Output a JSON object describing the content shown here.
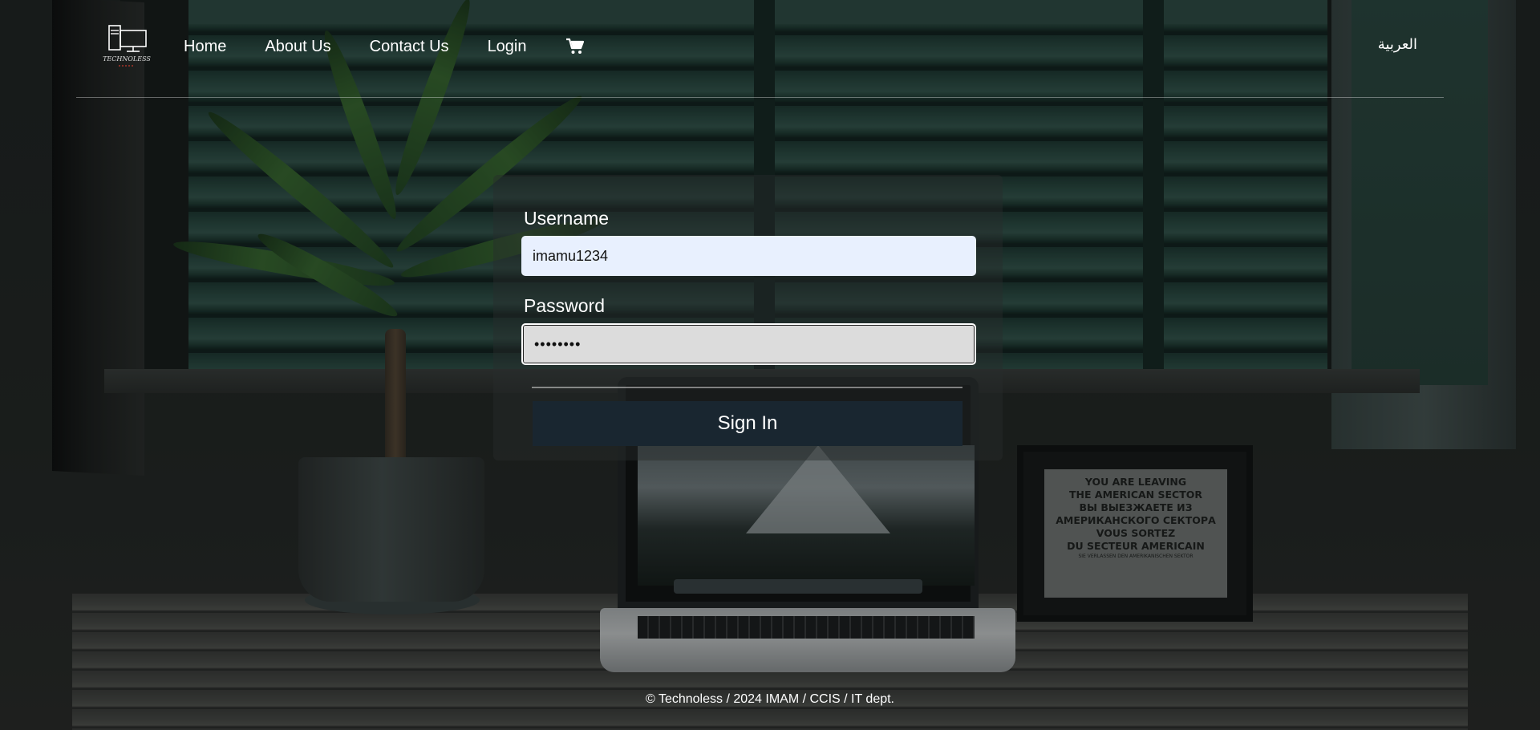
{
  "nav": {
    "links": [
      "Home",
      "About Us",
      "Contact Us",
      "Login"
    ],
    "language_label": "العربية",
    "logo_text": "TECHNOLESS"
  },
  "login": {
    "username_label": "Username",
    "username_value": "imamu1234",
    "password_label": "Password",
    "password_value": "••••••••",
    "signin_label": "Sign In"
  },
  "poster": {
    "lines": [
      "YOU ARE LEAVING",
      "THE AMERICAN SECTOR",
      "ВЫ ВЫЕЗЖАЕТЕ ИЗ",
      "АМЕРИКАНСКОГО СЕКТОРА",
      "VOUS SORTEZ",
      "DU SECTEUR AMERICAIN",
      "SIE VERLASSEN DEN AMERIKANISCHEN SEKTOR"
    ]
  },
  "footer": {
    "text": "© Technoless / 2024 IMAM / CCIS / IT dept."
  },
  "icons": {
    "cart": "cart-icon",
    "logo": "computer-logo-icon"
  },
  "colors": {
    "signin_bg": "#192630",
    "username_bg": "#e8f0fe",
    "password_bg": "#dcdcdc"
  }
}
